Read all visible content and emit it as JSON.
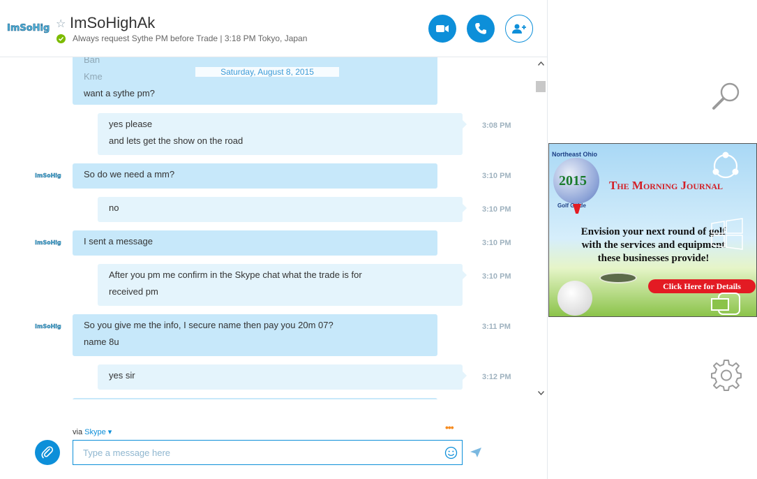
{
  "header": {
    "contact_name": "ImSoHighAk",
    "mood": "Always request Sythe PM before Trade | 3:18 PM Tokyo, Japan",
    "status_color": "#7cbb00",
    "accent_color": "#0d8fd9"
  },
  "chat": {
    "date": "Saturday, August 8, 2015",
    "partial_top_lines": [
      "Ban",
      "Kme"
    ],
    "messages": [
      {
        "sender": "them",
        "lines": [
          "want a sythe pm?"
        ],
        "time": ""
      },
      {
        "sender": "me",
        "lines": [
          "yes please",
          "and lets get the show on the road"
        ],
        "time": "3:08 PM"
      },
      {
        "sender": "them",
        "lines": [
          "So do we need a mm?"
        ],
        "time": "3:10 PM"
      },
      {
        "sender": "me",
        "lines": [
          "no"
        ],
        "time": "3:10 PM"
      },
      {
        "sender": "them",
        "lines": [
          "I sent a message"
        ],
        "time": "3:10 PM"
      },
      {
        "sender": "me",
        "lines": [
          "After you pm me confirm in the Skype chat what the trade is for",
          "received pm"
        ],
        "time": "3:10 PM"
      },
      {
        "sender": "them",
        "lines": [
          "So you give me the info, I secure name then pay you 20m 07?",
          "name 8u"
        ],
        "time": "3:11 PM"
      },
      {
        "sender": "me",
        "lines": [
          "yes sir"
        ],
        "time": "3:12 PM"
      }
    ]
  },
  "compose": {
    "via_label": "via",
    "via_service": "Skype",
    "placeholder": "Type a message here",
    "more_label": "•••"
  },
  "ad": {
    "badge_top": "Northeast Ohio",
    "year": "2015",
    "badge_bottom": "Golf Guide",
    "paper": "The Morning Journal",
    "line1": "Envision your next round of golf",
    "line2": "with the services and equipment",
    "line3": "these businesses provide!",
    "cta": "Click Here for Details"
  },
  "icons": {
    "header": [
      "video-call-icon",
      "audio-call-icon",
      "add-person-icon"
    ],
    "right": [
      "search-icon",
      "contacts-icon",
      "windows-icon",
      "devices-icon",
      "settings-icon"
    ],
    "compose": [
      "attach-icon",
      "emoji-icon",
      "send-icon"
    ]
  }
}
